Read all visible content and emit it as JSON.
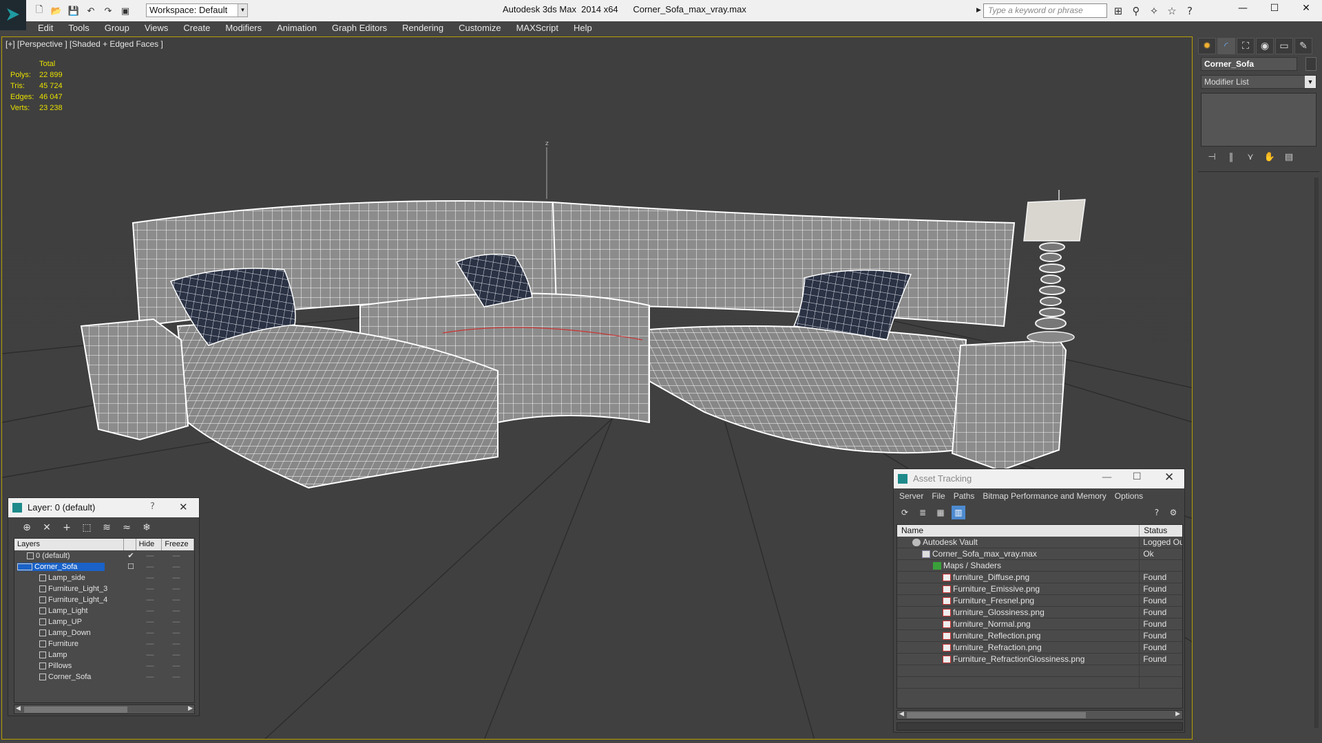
{
  "app": {
    "window_title": "Autodesk 3ds Max  2014 x64      Corner_Sofa_max_vray.max",
    "workspace": "Workspace: Default",
    "search_placeholder": "Type a keyword or phrase"
  },
  "menu": [
    "Edit",
    "Tools",
    "Group",
    "Views",
    "Create",
    "Modifiers",
    "Animation",
    "Graph Editors",
    "Rendering",
    "Customize",
    "MAXScript",
    "Help"
  ],
  "viewport": {
    "label": "[+] [Perspective ] [Shaded + Edged Faces ]",
    "stats": {
      "header": "Total",
      "rows": [
        {
          "label": "Polys:",
          "value": "22 899"
        },
        {
          "label": "Tris:",
          "value": "45 724"
        },
        {
          "label": "Edges:",
          "value": "46 047"
        },
        {
          "label": "Verts:",
          "value": "23 238"
        }
      ]
    },
    "axis_label": "z",
    "colors": {
      "stats": "#e8e000",
      "border": "#b8a000",
      "wire": "#f2f2f2",
      "mesh": "#8a8a8a"
    }
  },
  "command_panel": {
    "object_name": "Corner_Sofa",
    "modifier_list": "Modifier List"
  },
  "layer_dialog": {
    "title": "Layer: 0 (default)",
    "help": "?",
    "columns": {
      "layers": "Layers",
      "hide": "Hide",
      "freeze": "Freeze"
    },
    "rows": [
      {
        "name": "0 (default)",
        "level": 0,
        "checked": true
      },
      {
        "name": "Corner_Sofa",
        "level": 0,
        "selected": true
      },
      {
        "name": "Lamp_side",
        "level": 1
      },
      {
        "name": "Furniture_Light_3",
        "level": 1
      },
      {
        "name": "Furniture_Light_4",
        "level": 1
      },
      {
        "name": "Lamp_Light",
        "level": 1
      },
      {
        "name": "Lamp_UP",
        "level": 1
      },
      {
        "name": "Lamp_Down",
        "level": 1
      },
      {
        "name": "Furniture",
        "level": 1
      },
      {
        "name": "Lamp",
        "level": 1
      },
      {
        "name": "Pillows",
        "level": 1
      },
      {
        "name": "Corner_Sofa",
        "level": 1
      }
    ]
  },
  "asset_dialog": {
    "title": "Asset Tracking",
    "menu": [
      "Server",
      "File",
      "Paths",
      "Bitmap Performance and Memory",
      "Options"
    ],
    "columns": {
      "name": "Name",
      "status": "Status"
    },
    "rows": [
      {
        "name": "Autodesk Vault",
        "status": "Logged Out",
        "level": 0,
        "icon": "vault"
      },
      {
        "name": "Corner_Sofa_max_vray.max",
        "status": "Ok",
        "level": 1,
        "icon": "file"
      },
      {
        "name": "Maps / Shaders",
        "status": "",
        "level": 2,
        "icon": "maps"
      },
      {
        "name": "furniture_Diffuse.png",
        "status": "Found",
        "level": 3,
        "icon": "png"
      },
      {
        "name": "Furniture_Emissive.png",
        "status": "Found",
        "level": 3,
        "icon": "png"
      },
      {
        "name": "Furniture_Fresnel.png",
        "status": "Found",
        "level": 3,
        "icon": "png"
      },
      {
        "name": "furniture_Glossiness.png",
        "status": "Found",
        "level": 3,
        "icon": "png"
      },
      {
        "name": "furniture_Normal.png",
        "status": "Found",
        "level": 3,
        "icon": "png"
      },
      {
        "name": "furniture_Reflection.png",
        "status": "Found",
        "level": 3,
        "icon": "png"
      },
      {
        "name": "furniture_Refraction.png",
        "status": "Found",
        "level": 3,
        "icon": "png"
      },
      {
        "name": "Furniture_RefractionGlossiness.png",
        "status": "Found",
        "level": 3,
        "icon": "png"
      }
    ]
  }
}
